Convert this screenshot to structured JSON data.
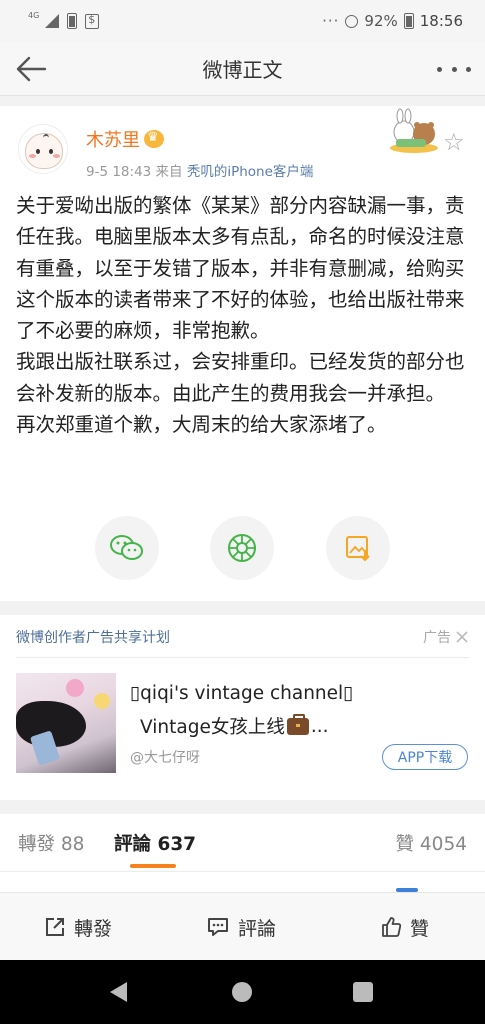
{
  "status_bar": {
    "network": "4G",
    "battery": "92%",
    "time": "18:56"
  },
  "nav": {
    "title": "微博正文"
  },
  "post": {
    "username": "木苏里",
    "date": "9-5 18:43",
    "source_prefix": "来自",
    "source": "秃叽的iPhone客户端",
    "paragraphs": [
      "关于爱呦出版的繁体《某某》部分内容缺漏一事，责任在我。电脑里版本太多有点乱，命名的时候没注意有重叠，以至于发错了版本，并非有意删减，给购买这个版本的读者带来了不好的体验，也给出版社带来了不必要的麻烦，非常抱歉。",
      "我跟出版社联系过，会安排重印。已经发货的部分也会补发新的版本。由此产生的费用我会一并承担。",
      "再次郑重道个歉，大周末的给大家添堵了。"
    ],
    "share_icons": [
      "wechat-icon",
      "moments-icon",
      "save-image-icon"
    ]
  },
  "ad": {
    "header": "微博创作者广告共享计划",
    "tag": "广告",
    "title_line1": "▯qiqi's vintage channel▯",
    "title_line2": "Vintage女孩上线",
    "title_suffix": "...",
    "user": "@大七仔呀",
    "button": "APP下载"
  },
  "tabs": {
    "repost": "轉發 88",
    "comment": "評論 637",
    "like": "贊 4054"
  },
  "actions": {
    "repost": "轉發",
    "comment": "評論",
    "like": "贊"
  },
  "colors": {
    "username": "#f5751f",
    "link": "#5a7ea9",
    "tab_accent": "#f5821f",
    "app_button": "#4a84d4"
  }
}
